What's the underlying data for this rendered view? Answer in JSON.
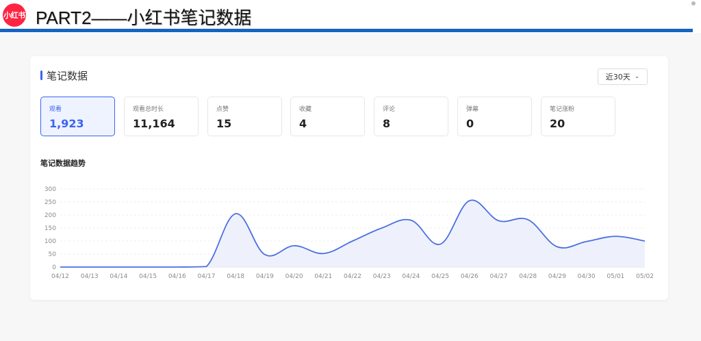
{
  "header": {
    "logo_text": "小红书",
    "title": "PART2——小红书笔记数据"
  },
  "panel": {
    "title": "笔记数据",
    "range_label": "近30天",
    "trend_title": "笔记数据趋势"
  },
  "metrics": [
    {
      "label": "观看",
      "value": "1,923",
      "active": true
    },
    {
      "label": "观看总时长",
      "value": "11,164",
      "active": false
    },
    {
      "label": "点赞",
      "value": "15",
      "active": false
    },
    {
      "label": "收藏",
      "value": "4",
      "active": false
    },
    {
      "label": "评论",
      "value": "8",
      "active": false
    },
    {
      "label": "弹幕",
      "value": "0",
      "active": false
    },
    {
      "label": "笔记涨粉",
      "value": "20",
      "active": false
    }
  ],
  "colors": {
    "accent": "#3a64f0",
    "line": "#4a6fe0",
    "area": "#eef1fb",
    "brand": "#ff2442",
    "rule": "#1565c0"
  },
  "chart_data": {
    "type": "area",
    "x": [
      "04/12",
      "04/13",
      "04/14",
      "04/15",
      "04/16",
      "04/17",
      "04/18",
      "04/19",
      "04/20",
      "04/21",
      "04/22",
      "04/23",
      "04/24",
      "04/25",
      "04/26",
      "04/27",
      "04/28",
      "04/29",
      "04/30",
      "05/01",
      "05/02"
    ],
    "values": [
      0,
      0,
      0,
      0,
      0,
      2,
      205,
      48,
      82,
      52,
      100,
      150,
      180,
      88,
      255,
      178,
      182,
      78,
      98,
      118,
      100
    ],
    "y_ticks": [
      0,
      50,
      100,
      150,
      200,
      250,
      300
    ],
    "ylim": [
      0,
      300
    ],
    "grid": true
  }
}
